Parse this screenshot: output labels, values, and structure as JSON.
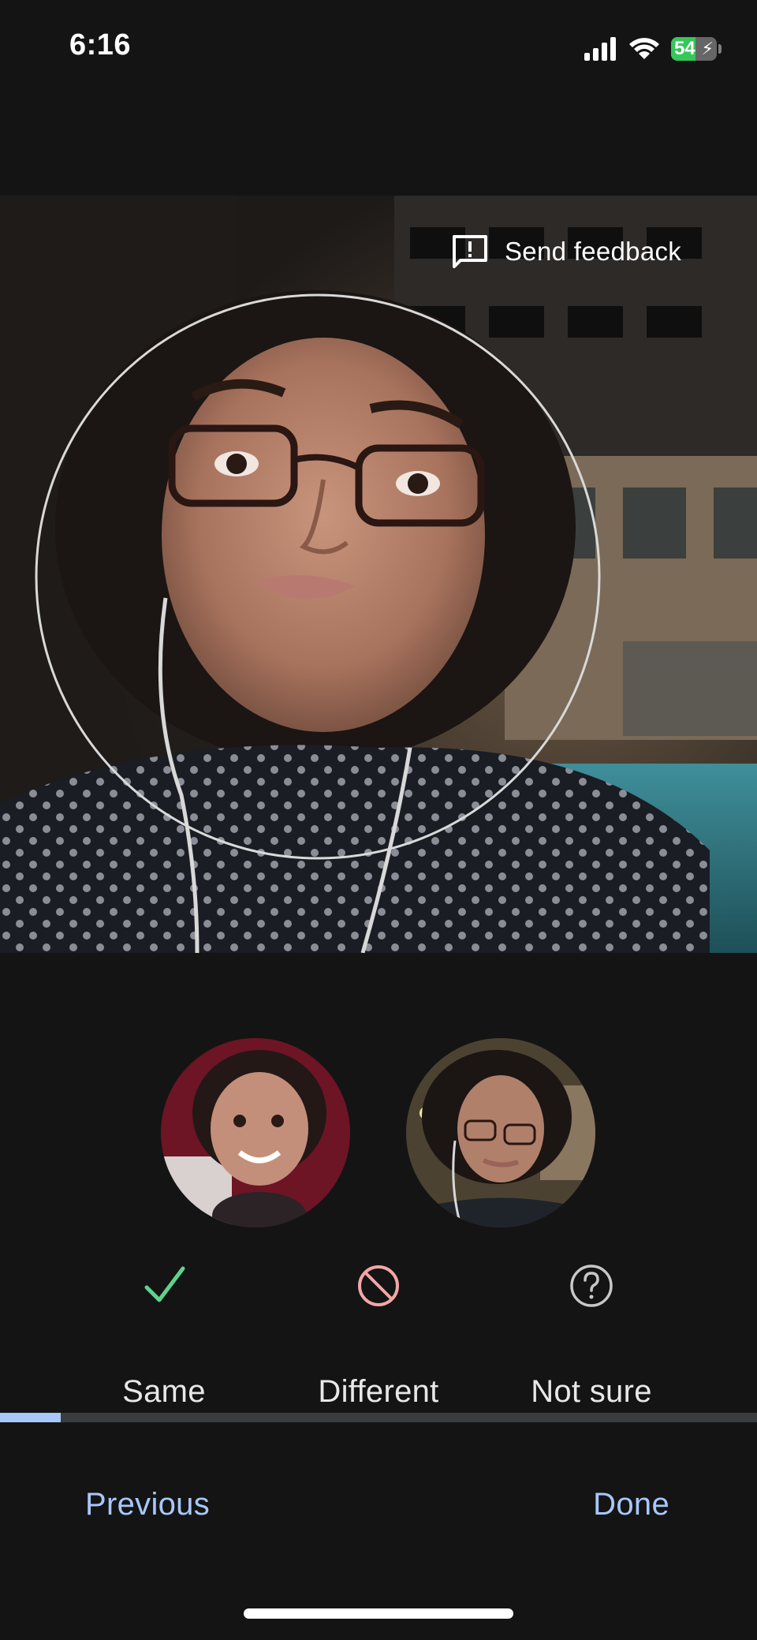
{
  "status_bar": {
    "time": "6:16",
    "battery_percent": "54",
    "battery_level": 0.54,
    "charging": true,
    "icons": [
      "cellular-signal-icon",
      "wifi-icon",
      "battery-charging-icon"
    ]
  },
  "photo": {
    "feedback_label": "Send feedback",
    "feedback_icon": "feedback-icon"
  },
  "comparison": {
    "thumbnails": [
      "face-thumbnail-child",
      "face-thumbnail-adult"
    ]
  },
  "choices": {
    "same": {
      "label": "Same",
      "icon": "checkmark-icon",
      "color": "#5fd38d"
    },
    "different": {
      "label": "Different",
      "icon": "block-icon",
      "color": "#f4a6a6"
    },
    "not_sure": {
      "label": "Not sure",
      "icon": "question-icon",
      "color": "#c8c8c8"
    }
  },
  "progress": {
    "fraction": 0.08
  },
  "nav": {
    "previous_label": "Previous",
    "done_label": "Done"
  },
  "colors": {
    "background": "#141414",
    "accent": "#a8c7fa",
    "progress_track": "#3a3d40"
  }
}
